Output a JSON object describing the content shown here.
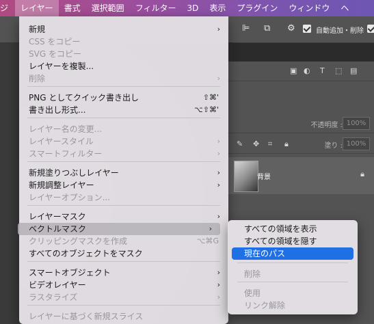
{
  "menubar": {
    "items": [
      "ジ",
      "レイヤー",
      "書式",
      "選択範囲",
      "フィルター",
      "3D",
      "表示",
      "プラグイン",
      "ウィンドウ",
      "ヘ"
    ]
  },
  "toolbar": {
    "auto_add_label": "自動追加・削除"
  },
  "panel": {
    "opacity_label": "不透明度 :",
    "opacity_value": "100%",
    "fill_label": "塗り :",
    "fill_value": "100%",
    "layer_name": "背景"
  },
  "menu": {
    "items": [
      {
        "label": "新規",
        "submenu": true,
        "disabled": false
      },
      {
        "label": "CSS をコピー",
        "disabled": true
      },
      {
        "label": "SVG をコピー",
        "disabled": true
      },
      {
        "label": "レイヤーを複製...",
        "disabled": false
      },
      {
        "label": "削除",
        "submenu": true,
        "disabled": true
      },
      {
        "label": "PNG としてクイック書き出し",
        "shortcut": "⇧⌘'",
        "disabled": false
      },
      {
        "label": "書き出し形式...",
        "shortcut": "⌥⇧⌘'",
        "disabled": false
      },
      {
        "label": "レイヤー名の変更...",
        "disabled": true
      },
      {
        "label": "レイヤースタイル",
        "submenu": true,
        "disabled": true
      },
      {
        "label": "スマートフィルター",
        "submenu": true,
        "disabled": true
      },
      {
        "label": "新規塗りつぶしレイヤー",
        "submenu": true,
        "disabled": false
      },
      {
        "label": "新規調整レイヤー",
        "submenu": true,
        "disabled": false
      },
      {
        "label": "レイヤーオプション...",
        "disabled": true
      },
      {
        "label": "レイヤーマスク",
        "submenu": true,
        "disabled": false
      },
      {
        "label": "ベクトルマスク",
        "submenu": true,
        "disabled": false,
        "highlighted": true
      },
      {
        "label": "クリッピングマスクを作成",
        "shortcut": "⌥⌘G",
        "disabled": true
      },
      {
        "label": "すべてのオブジェクトをマスク",
        "disabled": false
      },
      {
        "label": "スマートオブジェクト",
        "submenu": true,
        "disabled": false
      },
      {
        "label": "ビデオレイヤー",
        "submenu": true,
        "disabled": false
      },
      {
        "label": "ラスタライズ",
        "submenu": true,
        "disabled": true
      },
      {
        "label": "レイヤーに基づく新規スライス",
        "disabled": true
      }
    ]
  },
  "submenu": {
    "items": [
      {
        "label": "すべての領域を表示",
        "disabled": false
      },
      {
        "label": "すべての領域を隠す",
        "disabled": false
      },
      {
        "label": "現在のパス",
        "selected": true
      },
      {
        "label": "削除",
        "disabled": true
      },
      {
        "label": "使用",
        "disabled": true
      },
      {
        "label": "リンク解除",
        "disabled": true
      }
    ]
  },
  "colors": {
    "selection": "#1f6fe5",
    "menu_bg": "#e4e0e5",
    "app_bg": "#535353"
  }
}
